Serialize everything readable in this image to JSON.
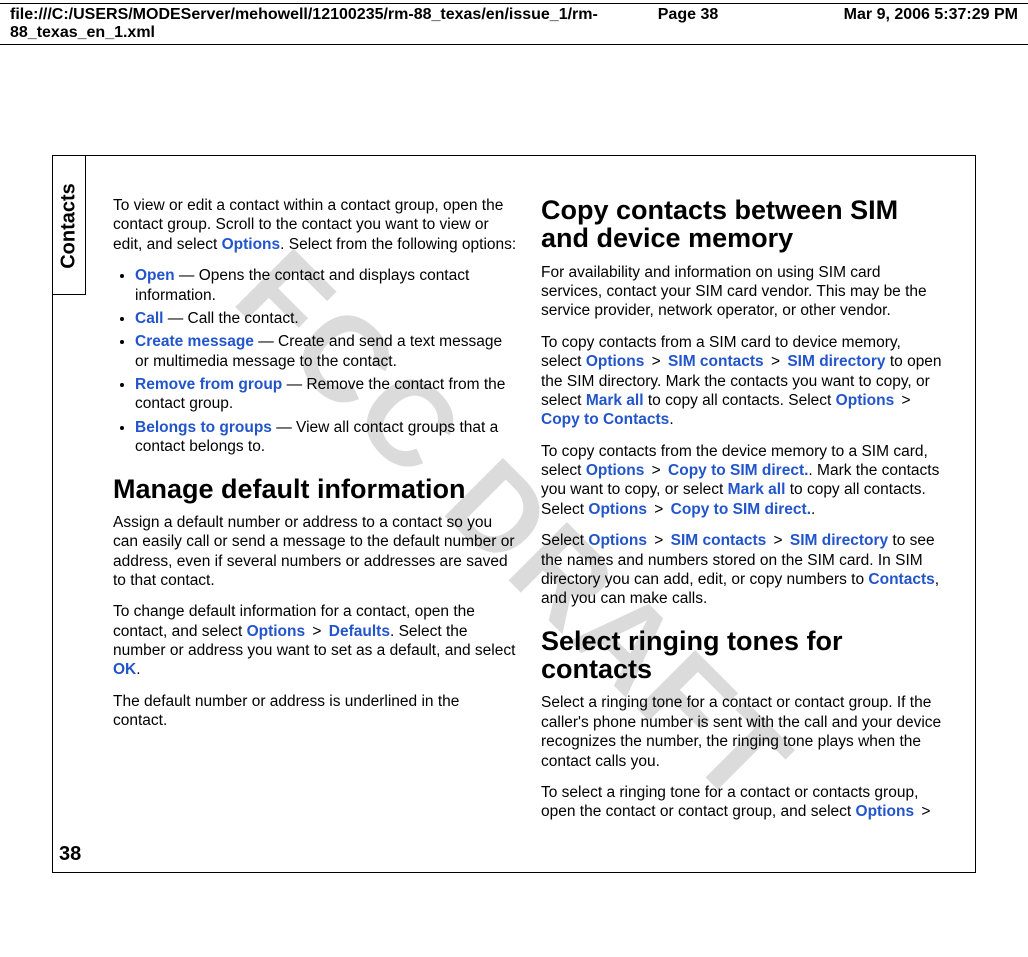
{
  "header": {
    "path": "file:///C:/USERS/MODEServer/mehowell/12100235/rm-88_texas/en/issue_1/rm-88_texas_en_1.xml",
    "page_label": "Page 38",
    "timestamp": "Mar 9, 2006 5:37:29 PM"
  },
  "sidetab": "Contacts",
  "watermark": "FCC DRAFT",
  "page_number": "38",
  "left_col": {
    "intro_pre": "To view or edit a contact within a contact group, open the contact group. Scroll to the contact you want to view or edit, and select ",
    "intro_ui": "Options",
    "intro_post": ". Select from the following options:",
    "opts": [
      {
        "ui": "Open",
        "desc": " — Opens the contact and displays contact information."
      },
      {
        "ui": "Call",
        "desc": " — Call the contact."
      },
      {
        "ui": "Create message",
        "desc": " — Create and send a text message or multimedia message to the contact."
      },
      {
        "ui": "Remove from group",
        "desc": " — Remove the contact from the contact group."
      },
      {
        "ui": "Belongs to groups",
        "desc": " — View all contact groups that a contact belongs to."
      }
    ],
    "h1": "Manage default information",
    "p1": "Assign a default number or address to a contact so you can easily call or send a message to the default number or address, even if several numbers or addresses are saved to that contact.",
    "p2_a": "To change default information for a contact, open the contact, and select ",
    "p2_u1": "Options",
    "p2_gt1": " > ",
    "p2_u2": "Defaults",
    "p2_b": ". Select the number or address you want to set as a default, and select ",
    "p2_u3": "OK",
    "p2_c": ".",
    "p3": "The default number or address is underlined in the contact."
  },
  "right_col": {
    "h1a": "Copy contacts between SIM and device memory",
    "p1": "For availability and information on using SIM card services, contact your SIM card vendor. This may be the service provider, network operator, or other vendor.",
    "p2_a": "To copy contacts from a SIM card to device memory, select ",
    "p2_u1": "Options",
    "p2_gt1": " > ",
    "p2_u2": "SIM contacts",
    "p2_gt2": " > ",
    "p2_u3": "SIM directory",
    "p2_b": " to open the SIM directory. Mark the contacts you want to copy, or select ",
    "p2_u4": "Mark all",
    "p2_c": " to copy all contacts. Select ",
    "p2_u5": "Options",
    "p2_gt3": " > ",
    "p2_u6": "Copy to Contacts",
    "p2_d": ".",
    "p3_a": "To copy contacts from the device memory to a SIM card, select ",
    "p3_u1": "Options",
    "p3_gt1": " > ",
    "p3_u2": "Copy to SIM direct.",
    "p3_b": ". Mark the contacts you want to copy, or select ",
    "p3_u3": "Mark all",
    "p3_c": " to copy all contacts. Select ",
    "p3_u4": "Options",
    "p3_gt2": " > ",
    "p3_u5": "Copy to SIM direct.",
    "p3_d": ".",
    "p4_a": "Select ",
    "p4_u1": "Options",
    "p4_gt1": " > ",
    "p4_u2": "SIM contacts",
    "p4_gt2": " > ",
    "p4_u3": "SIM directory",
    "p4_b": " to see the names and numbers stored on the SIM card. In SIM directory you can add, edit, or copy numbers to ",
    "p4_u4": "Contacts",
    "p4_c": ", and you can make calls.",
    "h1b": "Select ringing tones for contacts",
    "p5": "Select a ringing tone for a contact or contact group. If the caller's phone number is sent with the call and your device recognizes the number, the ringing tone plays when the contact calls you.",
    "p6_a": "To select a ringing tone for a contact or contacts group, open the contact or contact group, and select ",
    "p6_u1": "Options",
    "p6_gt1": " > "
  }
}
